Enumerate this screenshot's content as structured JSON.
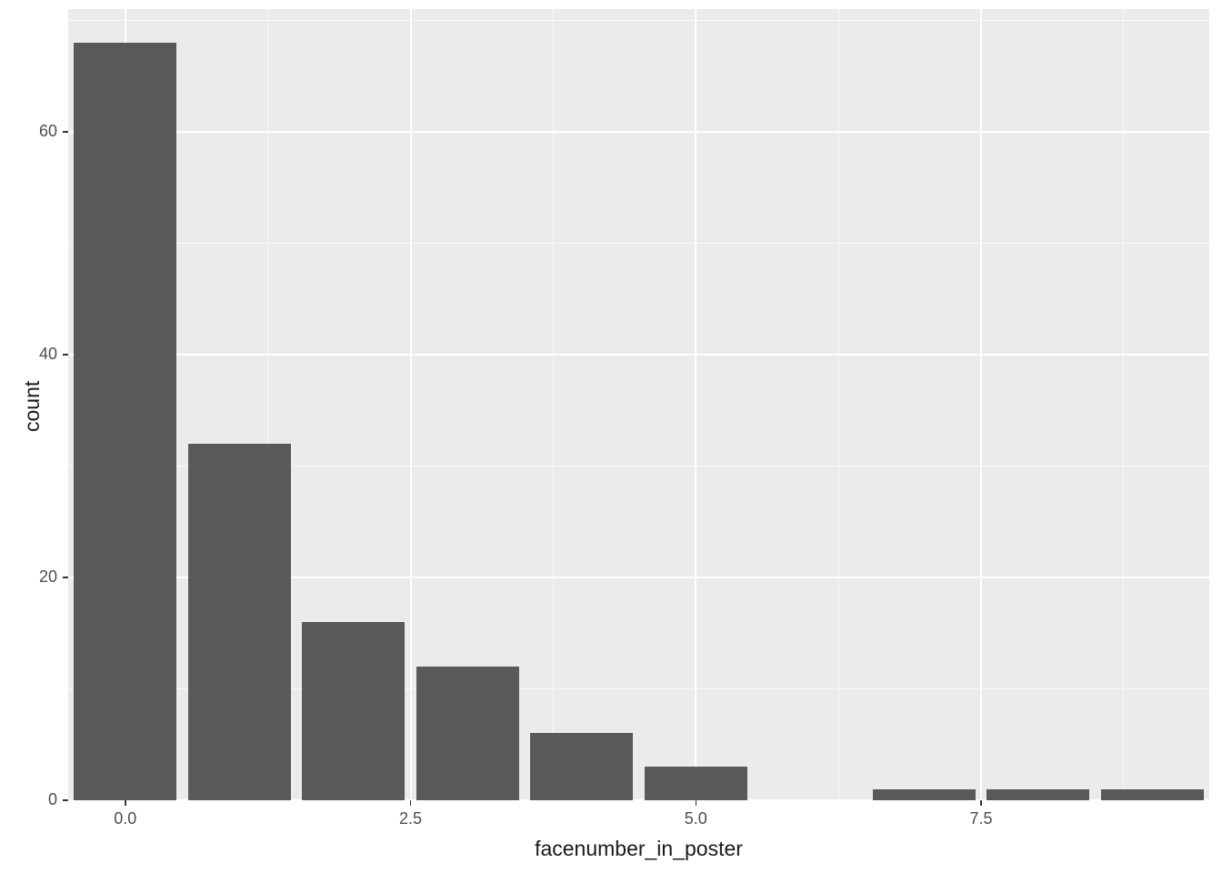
{
  "chart_data": {
    "type": "bar",
    "categories": [
      0,
      1,
      2,
      3,
      4,
      5,
      7,
      8,
      9
    ],
    "values": [
      68,
      32,
      16,
      12,
      6,
      3,
      1,
      1,
      1
    ],
    "title": "",
    "xlabel": "facenumber_in_poster",
    "ylabel": "count",
    "xlim": [
      -0.5,
      9.5
    ],
    "ylim": [
      0,
      71
    ],
    "x_ticks": [
      0.0,
      2.5,
      5.0,
      7.5
    ],
    "x_tick_labels": [
      "0.0",
      "2.5",
      "5.0",
      "7.5"
    ],
    "y_ticks": [
      0,
      20,
      40,
      60
    ],
    "y_tick_labels": [
      "0",
      "20",
      "40",
      "60"
    ],
    "bar_color": "#595959",
    "panel_bg": "#ebebeb",
    "bar_width": 0.9
  }
}
